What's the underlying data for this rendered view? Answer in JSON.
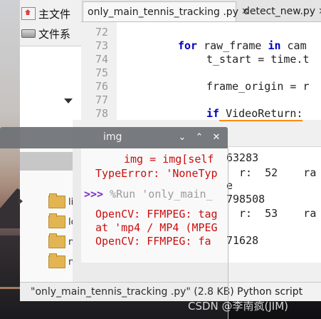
{
  "file_manager": {
    "sidebar": [
      {
        "label": "主文件",
        "icon": "home-folder-icon"
      },
      {
        "label": "文件系",
        "icon": "drive-icon"
      }
    ],
    "files": [
      {
        "label": "li"
      },
      {
        "label": "lc"
      },
      {
        "label": "n"
      },
      {
        "label": "n"
      }
    ]
  },
  "status_bar": {
    "text": "\"only_main_tennis_tracking .py\" (2.8 KB) Python script"
  },
  "editor": {
    "tabs": [
      {
        "label": "only_main_tennis_tracking .py",
        "close": "✕",
        "active": true
      },
      {
        "label": "detect_new.py",
        "close": "✕",
        "active": false
      }
    ],
    "line_numbers": [
      "72",
      "73",
      "74",
      "75",
      "76",
      "77",
      "78"
    ],
    "code": {
      "l73_kw1": "for",
      "l73_mid": " raw_frame ",
      "l73_kw2": "in",
      "l73_end": " cam",
      "l74": "t_start = time.t",
      "l76": "frame_origin = r",
      "l78_kw": "if",
      "l78_end": " VideoReturn:"
    }
  },
  "shell": {
    "lines": {
      "l1": "img = img[self",
      "l2": "TypeError: 'NoneTyp",
      "l3_prompt": ">>>",
      "l3_text": " %Run 'only_main_",
      "l4": "OpenCV: FFMPEG: tag",
      "l5": "at 'mp4 / MP4 (MPEG",
      "l6": "OpenCV: FFMPEG: fa"
    },
    "overlay": {
      "o1": "63283",
      "o2a": "r:  52    ra",
      "o2b": "e",
      "o3": "798508",
      "o4": "r:  53    ra",
      "o5": "71628"
    }
  },
  "img_window": {
    "title": "img",
    "buttons": {
      "dropdown": "⌄",
      "minimize": "⌃",
      "close": "✕"
    }
  },
  "watermark": "CSDN @李南疯(JIM)"
}
